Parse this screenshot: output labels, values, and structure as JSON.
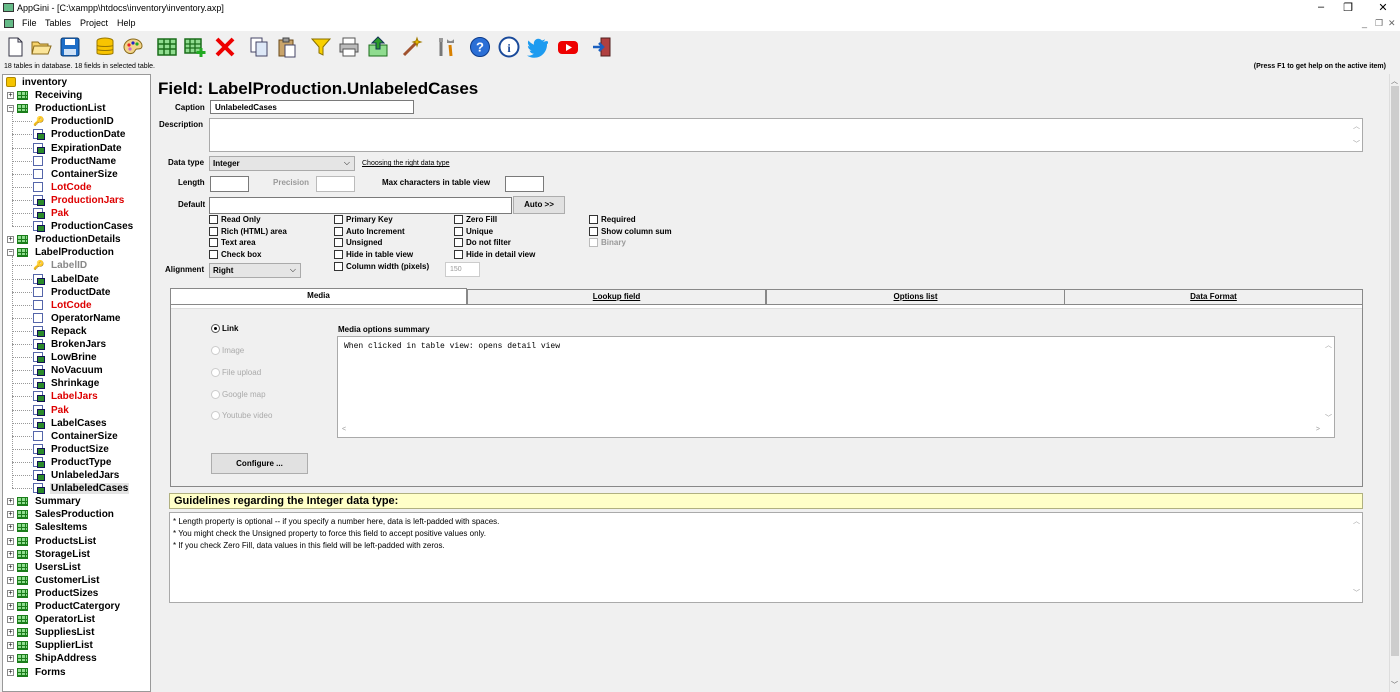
{
  "window": {
    "title": "AppGini - [C:\\xampp\\htdocs\\inventory\\inventory.axp]",
    "minimize": "–",
    "restore": "❐",
    "close": "✕"
  },
  "menu": {
    "items": [
      "File",
      "Tables",
      "Project",
      "Help"
    ],
    "mdi_min": "_",
    "mdi_restore": "❐",
    "mdi_close": "✕"
  },
  "toolbar": {
    "icons": [
      "new-file-icon",
      "open-folder-icon",
      "save-icon",
      "database-icon",
      "palette-icon",
      "table-icon",
      "add-table-icon",
      "delete-icon",
      "copy-icon",
      "paste-icon",
      "filter-icon",
      "print-icon",
      "export-icon",
      "magic-wand-icon",
      "tools-icon",
      "help-icon",
      "info-icon",
      "twitter-icon",
      "youtube-icon",
      "exit-icon"
    ]
  },
  "status": {
    "left": "18 tables in database. 18 fields in selected table.",
    "right": "(Press F1 to get help on the active item)"
  },
  "tree": {
    "root": "inventory",
    "tables": [
      {
        "name": "Receiving",
        "expanded": false
      },
      {
        "name": "ProductionList",
        "expanded": true,
        "fields": [
          {
            "name": "ProductionID",
            "type": "key"
          },
          {
            "name": "ProductionDate",
            "type": "lookup"
          },
          {
            "name": "ExpirationDate",
            "type": "lookup"
          },
          {
            "name": "ProductName",
            "type": "field"
          },
          {
            "name": "ContainerSize",
            "type": "field"
          },
          {
            "name": "LotCode",
            "type": "field",
            "color": "red"
          },
          {
            "name": "ProductionJars",
            "type": "lookup",
            "color": "red"
          },
          {
            "name": "Pak",
            "type": "lookup",
            "color": "red"
          },
          {
            "name": "ProductionCases",
            "type": "lookup"
          }
        ]
      },
      {
        "name": "ProductionDetails",
        "expanded": false
      },
      {
        "name": "LabelProduction",
        "expanded": true,
        "fields": [
          {
            "name": "LabelID",
            "type": "key",
            "color": "gray"
          },
          {
            "name": "LabelDate",
            "type": "lookup"
          },
          {
            "name": "ProductDate",
            "type": "field"
          },
          {
            "name": "LotCode",
            "type": "field",
            "color": "red"
          },
          {
            "name": "OperatorName",
            "type": "field"
          },
          {
            "name": "Repack",
            "type": "lookup"
          },
          {
            "name": "BrokenJars",
            "type": "lookup"
          },
          {
            "name": "LowBrine",
            "type": "lookup"
          },
          {
            "name": "NoVacuum",
            "type": "lookup"
          },
          {
            "name": "Shrinkage",
            "type": "lookup"
          },
          {
            "name": "LabelJars",
            "type": "lookup",
            "color": "red"
          },
          {
            "name": "Pak",
            "type": "lookup",
            "color": "red"
          },
          {
            "name": "LabelCases",
            "type": "lookup"
          },
          {
            "name": "ContainerSize",
            "type": "field"
          },
          {
            "name": "ProductSize",
            "type": "lookup"
          },
          {
            "name": "ProductType",
            "type": "lookup"
          },
          {
            "name": "UnlabeledJars",
            "type": "lookup"
          },
          {
            "name": "UnlabeledCases",
            "type": "lookup",
            "selected": true
          }
        ]
      },
      {
        "name": "Summary",
        "expanded": false
      },
      {
        "name": "SalesProduction",
        "expanded": false
      },
      {
        "name": "SalesItems",
        "expanded": false
      },
      {
        "name": "ProductsList",
        "expanded": false
      },
      {
        "name": "StorageList",
        "expanded": false
      },
      {
        "name": "UsersList",
        "expanded": false
      },
      {
        "name": "CustomerList",
        "expanded": false
      },
      {
        "name": "ProductSizes",
        "expanded": false
      },
      {
        "name": "ProductCatergory",
        "expanded": false
      },
      {
        "name": "OperatorList",
        "expanded": false
      },
      {
        "name": "SuppliesList",
        "expanded": false
      },
      {
        "name": "SupplierList",
        "expanded": false
      },
      {
        "name": "ShipAddress",
        "expanded": false
      },
      {
        "name": "Forms",
        "expanded": false
      }
    ]
  },
  "field": {
    "heading": "Field: LabelProduction.UnlabeledCases",
    "caption_label": "Caption",
    "caption_value": "UnlabeledCases",
    "description_label": "Description",
    "description_value": "",
    "datatype_label": "Data type",
    "datatype_value": "Integer",
    "datatype_link": "Choosing the right data type",
    "length_label": "Length",
    "length_value": "",
    "precision_label": "Precision",
    "precision_value": "",
    "maxchars_label": "Max characters in table view",
    "maxchars_value": "",
    "default_label": "Default",
    "default_value": "",
    "auto_button": "Auto >>",
    "alignment_label": "Alignment",
    "alignment_value": "Right",
    "column_width_value": "150",
    "checkboxes": {
      "read_only": "Read Only",
      "rich_html": "Rich (HTML) area",
      "text_area": "Text area",
      "check_box": "Check box",
      "primary_key": "Primary Key",
      "auto_increment": "Auto Increment",
      "unsigned": "Unsigned",
      "hide_table": "Hide in table view",
      "column_width": "Column width (pixels)",
      "zero_fill": "Zero Fill",
      "unique": "Unique",
      "do_not_filter": "Do not filter",
      "hide_detail": "Hide in detail view",
      "required": "Required",
      "show_sum": "Show column sum",
      "binary": "Binary"
    }
  },
  "tabs": {
    "items": [
      "Media",
      "Lookup field",
      "Options list",
      "Data Format"
    ],
    "active": "Media"
  },
  "media": {
    "options": [
      {
        "label": "Link",
        "state": "on"
      },
      {
        "label": "Image",
        "state": "off"
      },
      {
        "label": "File upload",
        "state": "off"
      },
      {
        "label": "Google map",
        "state": "off"
      },
      {
        "label": "Youtube video",
        "state": "off"
      }
    ],
    "summary_label": "Media options summary",
    "summary_text": "When clicked in table view: opens detail view",
    "configure_button": "Configure ..."
  },
  "guidelines": {
    "title": "Guidelines regarding the Integer data type:",
    "lines": [
      "* Length property is optional -- if you specify a number here, data is left-padded with spaces.",
      "* You might check the Unsigned property to force this field to accept positive values only.",
      "* If you check Zero Fill, data values in this field will be left-padded with zeros."
    ]
  }
}
